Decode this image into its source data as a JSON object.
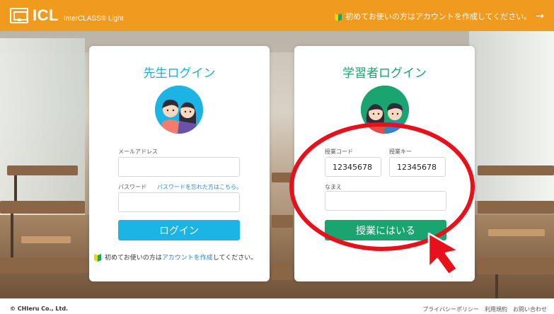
{
  "header": {
    "logo_text": "ICL",
    "logo_sub": "InterCLASS® Light",
    "first_time_link": "初めてお使いの方はアカウントを作成してください。",
    "arrow": "→"
  },
  "teacher": {
    "title": "先生ログイン",
    "email_label": "メールアドレス",
    "email_value": "",
    "password_label": "パスワード",
    "forgot_link": "パスワードを忘れた方はこちら。",
    "password_value": "",
    "login_button": "ログイン",
    "info_prefix": "初めてお使いの方は",
    "info_link": "アカウントを作成",
    "info_suffix": "してください。"
  },
  "student": {
    "title": "学習者ログイン",
    "class_code_label": "授業コード",
    "class_code_value": "12345678",
    "class_key_label": "授業キー",
    "class_key_value": "12345678",
    "name_label": "なまえ",
    "name_value": "",
    "enter_button": "授業にはいる"
  },
  "footer": {
    "copyright": "© CHIeru Co., Ltd.",
    "links": [
      "プライバシーポリシー",
      "利用規約",
      "お問い合わせ"
    ]
  },
  "colors": {
    "header": "#f09a1e",
    "teacher_accent": "#1cb4e4",
    "student_accent": "#19a470",
    "annotation": "#e8101a"
  }
}
